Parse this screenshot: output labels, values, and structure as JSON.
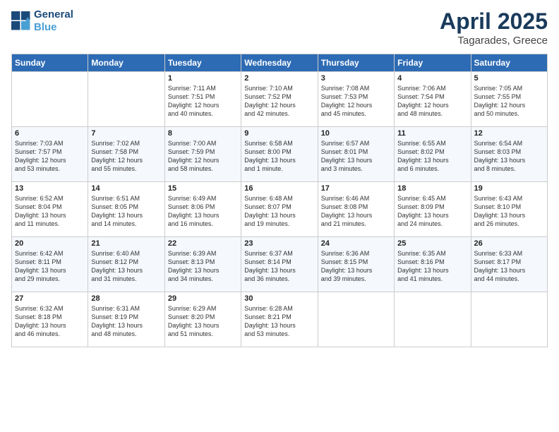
{
  "header": {
    "logo_line1": "General",
    "logo_line2": "Blue",
    "month_year": "April 2025",
    "location": "Tagarades, Greece"
  },
  "days_of_week": [
    "Sunday",
    "Monday",
    "Tuesday",
    "Wednesday",
    "Thursday",
    "Friday",
    "Saturday"
  ],
  "weeks": [
    [
      {
        "day": "",
        "info": ""
      },
      {
        "day": "",
        "info": ""
      },
      {
        "day": "1",
        "info": "Sunrise: 7:11 AM\nSunset: 7:51 PM\nDaylight: 12 hours\nand 40 minutes."
      },
      {
        "day": "2",
        "info": "Sunrise: 7:10 AM\nSunset: 7:52 PM\nDaylight: 12 hours\nand 42 minutes."
      },
      {
        "day": "3",
        "info": "Sunrise: 7:08 AM\nSunset: 7:53 PM\nDaylight: 12 hours\nand 45 minutes."
      },
      {
        "day": "4",
        "info": "Sunrise: 7:06 AM\nSunset: 7:54 PM\nDaylight: 12 hours\nand 48 minutes."
      },
      {
        "day": "5",
        "info": "Sunrise: 7:05 AM\nSunset: 7:55 PM\nDaylight: 12 hours\nand 50 minutes."
      }
    ],
    [
      {
        "day": "6",
        "info": "Sunrise: 7:03 AM\nSunset: 7:57 PM\nDaylight: 12 hours\nand 53 minutes."
      },
      {
        "day": "7",
        "info": "Sunrise: 7:02 AM\nSunset: 7:58 PM\nDaylight: 12 hours\nand 55 minutes."
      },
      {
        "day": "8",
        "info": "Sunrise: 7:00 AM\nSunset: 7:59 PM\nDaylight: 12 hours\nand 58 minutes."
      },
      {
        "day": "9",
        "info": "Sunrise: 6:58 AM\nSunset: 8:00 PM\nDaylight: 13 hours\nand 1 minute."
      },
      {
        "day": "10",
        "info": "Sunrise: 6:57 AM\nSunset: 8:01 PM\nDaylight: 13 hours\nand 3 minutes."
      },
      {
        "day": "11",
        "info": "Sunrise: 6:55 AM\nSunset: 8:02 PM\nDaylight: 13 hours\nand 6 minutes."
      },
      {
        "day": "12",
        "info": "Sunrise: 6:54 AM\nSunset: 8:03 PM\nDaylight: 13 hours\nand 8 minutes."
      }
    ],
    [
      {
        "day": "13",
        "info": "Sunrise: 6:52 AM\nSunset: 8:04 PM\nDaylight: 13 hours\nand 11 minutes."
      },
      {
        "day": "14",
        "info": "Sunrise: 6:51 AM\nSunset: 8:05 PM\nDaylight: 13 hours\nand 14 minutes."
      },
      {
        "day": "15",
        "info": "Sunrise: 6:49 AM\nSunset: 8:06 PM\nDaylight: 13 hours\nand 16 minutes."
      },
      {
        "day": "16",
        "info": "Sunrise: 6:48 AM\nSunset: 8:07 PM\nDaylight: 13 hours\nand 19 minutes."
      },
      {
        "day": "17",
        "info": "Sunrise: 6:46 AM\nSunset: 8:08 PM\nDaylight: 13 hours\nand 21 minutes."
      },
      {
        "day": "18",
        "info": "Sunrise: 6:45 AM\nSunset: 8:09 PM\nDaylight: 13 hours\nand 24 minutes."
      },
      {
        "day": "19",
        "info": "Sunrise: 6:43 AM\nSunset: 8:10 PM\nDaylight: 13 hours\nand 26 minutes."
      }
    ],
    [
      {
        "day": "20",
        "info": "Sunrise: 6:42 AM\nSunset: 8:11 PM\nDaylight: 13 hours\nand 29 minutes."
      },
      {
        "day": "21",
        "info": "Sunrise: 6:40 AM\nSunset: 8:12 PM\nDaylight: 13 hours\nand 31 minutes."
      },
      {
        "day": "22",
        "info": "Sunrise: 6:39 AM\nSunset: 8:13 PM\nDaylight: 13 hours\nand 34 minutes."
      },
      {
        "day": "23",
        "info": "Sunrise: 6:37 AM\nSunset: 8:14 PM\nDaylight: 13 hours\nand 36 minutes."
      },
      {
        "day": "24",
        "info": "Sunrise: 6:36 AM\nSunset: 8:15 PM\nDaylight: 13 hours\nand 39 minutes."
      },
      {
        "day": "25",
        "info": "Sunrise: 6:35 AM\nSunset: 8:16 PM\nDaylight: 13 hours\nand 41 minutes."
      },
      {
        "day": "26",
        "info": "Sunrise: 6:33 AM\nSunset: 8:17 PM\nDaylight: 13 hours\nand 44 minutes."
      }
    ],
    [
      {
        "day": "27",
        "info": "Sunrise: 6:32 AM\nSunset: 8:18 PM\nDaylight: 13 hours\nand 46 minutes."
      },
      {
        "day": "28",
        "info": "Sunrise: 6:31 AM\nSunset: 8:19 PM\nDaylight: 13 hours\nand 48 minutes."
      },
      {
        "day": "29",
        "info": "Sunrise: 6:29 AM\nSunset: 8:20 PM\nDaylight: 13 hours\nand 51 minutes."
      },
      {
        "day": "30",
        "info": "Sunrise: 6:28 AM\nSunset: 8:21 PM\nDaylight: 13 hours\nand 53 minutes."
      },
      {
        "day": "",
        "info": ""
      },
      {
        "day": "",
        "info": ""
      },
      {
        "day": "",
        "info": ""
      }
    ]
  ]
}
